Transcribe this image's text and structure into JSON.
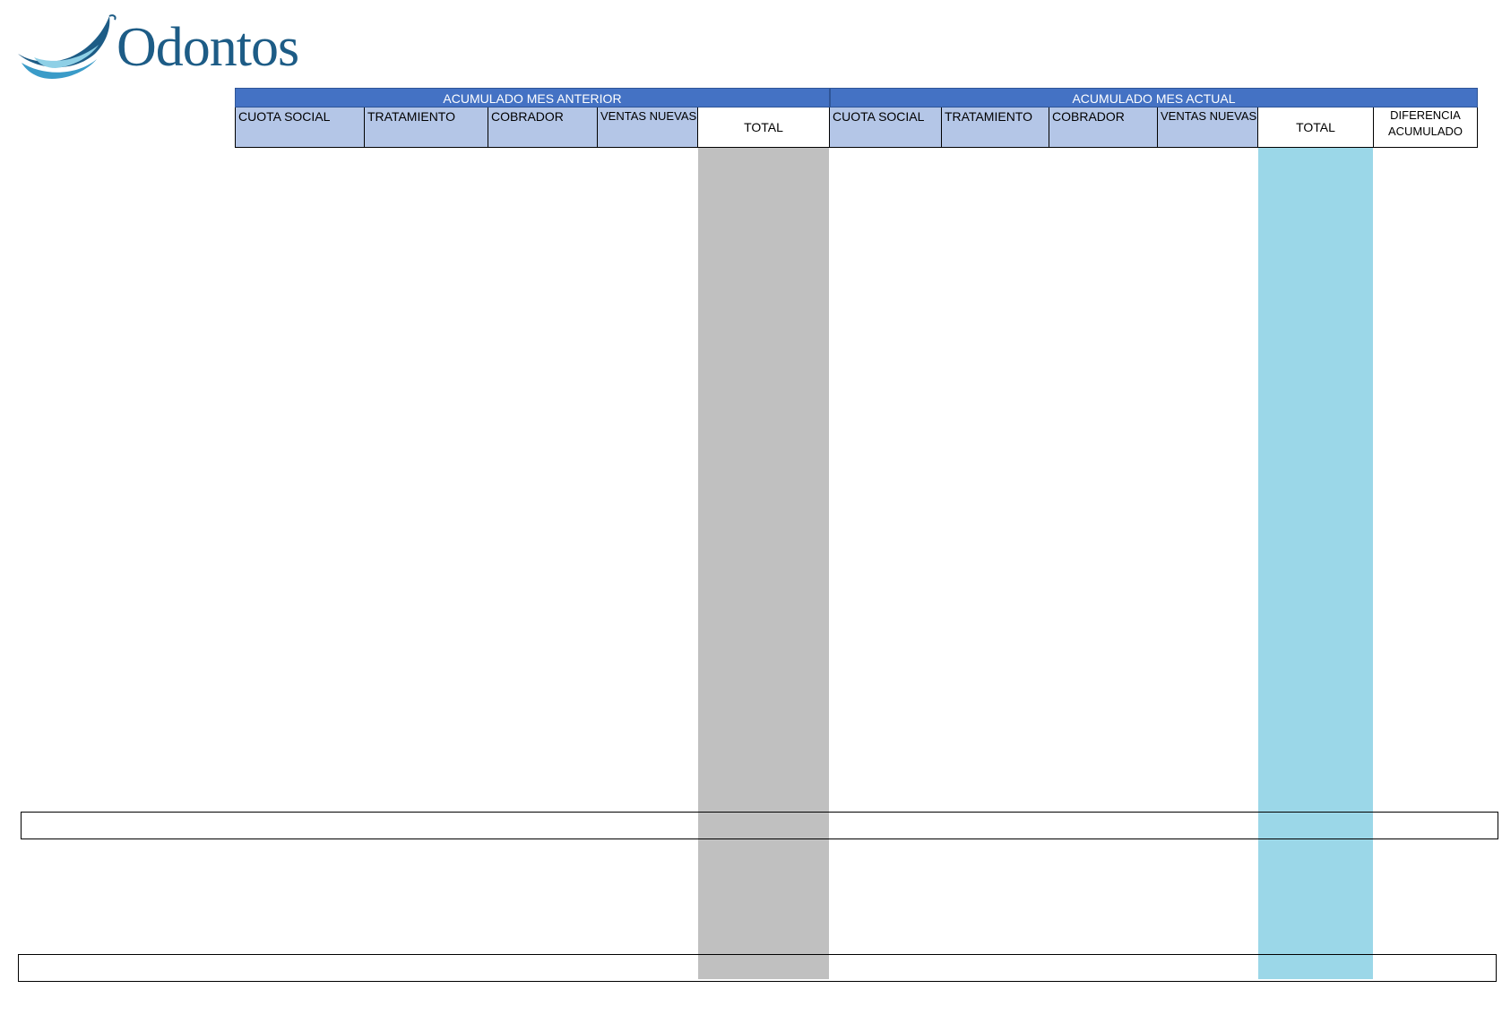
{
  "logo": {
    "brand_name": "Odontos"
  },
  "header": {
    "group_previous": "ACUMULADO MES ANTERIOR",
    "group_current": "ACUMULADO MES ACTUAL",
    "previous_columns": [
      "CUOTA SOCIAL",
      "TRATAMIENTO",
      "COBRADOR",
      "VENTAS NUEVAS",
      "TOTAL"
    ],
    "current_columns": [
      "CUOTA SOCIAL",
      "TRATAMIENTO",
      "COBRADOR",
      "VENTAS NUEVAS",
      "TOTAL"
    ],
    "difference_line1": "DIFERENCIA",
    "difference_line2": "ACUMULADO"
  },
  "colors": {
    "group_header": "#4472c4",
    "column_header": "#b4c6e7",
    "total_previous_fill": "#c0c0c0",
    "total_current_fill": "#9bd7e8",
    "logo": "#1d5c86"
  }
}
